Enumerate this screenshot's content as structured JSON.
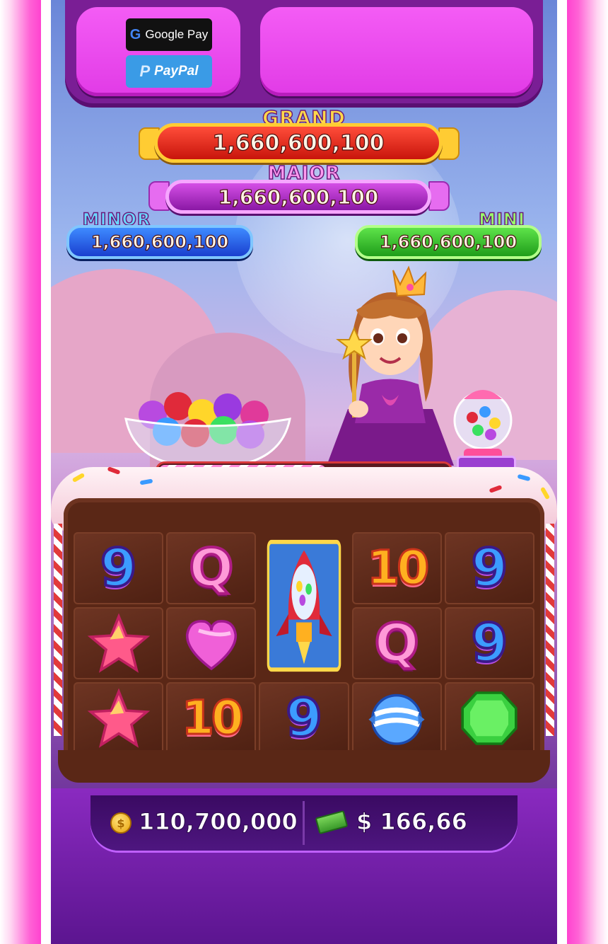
{
  "payments": {
    "google_pay_label": "Google Pay",
    "google_g": "G",
    "paypal_label": "PayPal",
    "paypal_p": "P"
  },
  "jackpots": {
    "grand": {
      "label": "GRAND",
      "value": "1,660,600,100",
      "color": "#e0241a"
    },
    "major": {
      "label": "MAJOR",
      "value": "1,660,600,100",
      "color": "#b02ac8"
    },
    "minor": {
      "label": "MINOR",
      "value": "1,660,600,100",
      "color": "#2a5cf0"
    },
    "mini": {
      "label": "MINI",
      "value": "1,660,600,100",
      "color": "#2fb024"
    }
  },
  "progress": {
    "fraction": 0.57
  },
  "reels": {
    "rows": [
      [
        "9",
        "Q",
        "rocket-gumball",
        "10",
        "9"
      ],
      [
        "star-candy",
        "heart-candy",
        "rocket-gumball",
        "Q",
        "9"
      ],
      [
        "star-candy",
        "10",
        "9",
        "swirl-candy",
        "green-gem"
      ]
    ]
  },
  "balance": {
    "coins": "110,700,000",
    "cash": "$ 166,66",
    "coin_icon": "coin-icon",
    "cash_icon": "cash-icon"
  },
  "colors": {
    "frame_neon": "#ff3fcf",
    "panel_pink": "#e13be6",
    "board_chocolate": "#5a2716"
  }
}
